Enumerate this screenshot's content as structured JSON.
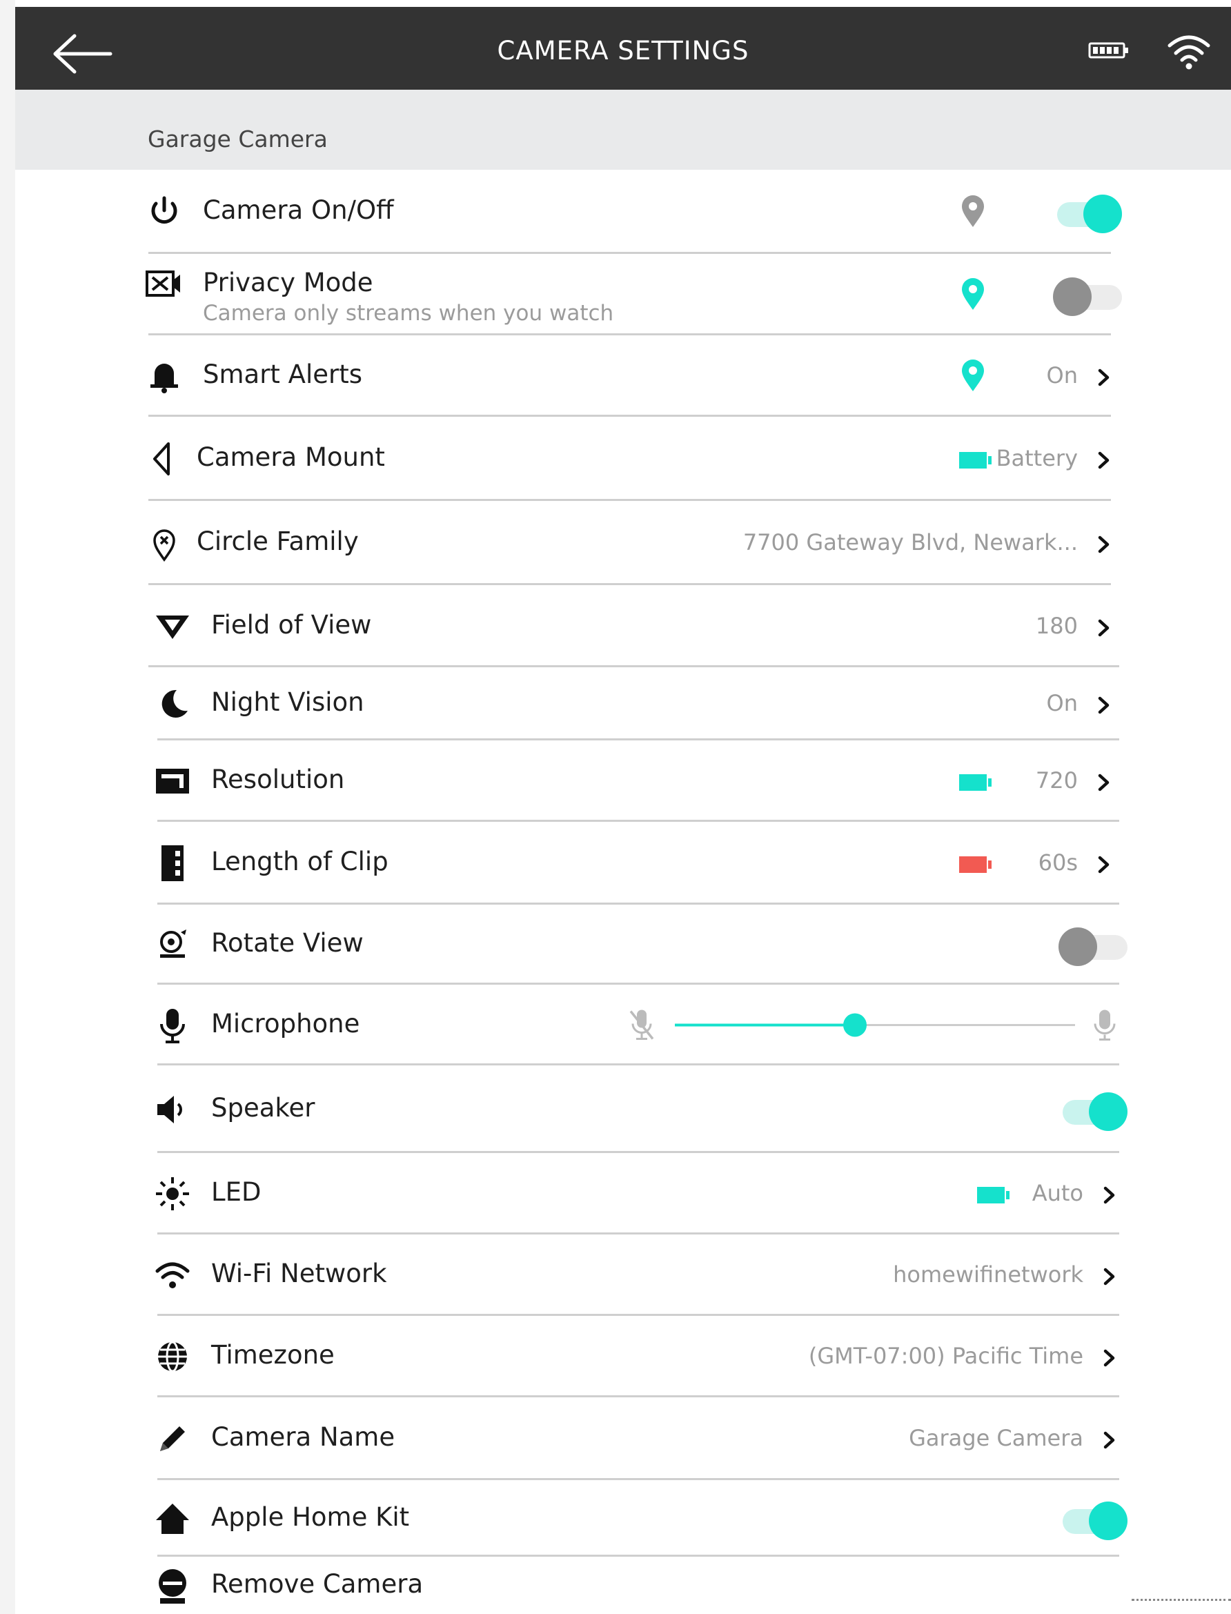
{
  "header": {
    "title": "CAMERA SETTINGS"
  },
  "section_label": "Garage Camera",
  "colors": {
    "accent": "#15e1cc",
    "warning": "#f25a52",
    "header_bg": "#333333"
  },
  "rows": [
    {
      "label": "Camera On/Off",
      "icon": "power-icon",
      "location_pin": "gray",
      "toggle": "on"
    },
    {
      "label": "Privacy Mode",
      "sublabel": "Camera only streams when you watch",
      "icon": "privacy-camera-icon",
      "location_pin": "teal",
      "toggle": "off"
    },
    {
      "label": "Smart Alerts",
      "icon": "bell-icon",
      "location_pin": "teal",
      "value": "On"
    },
    {
      "label": "Camera Mount",
      "icon": "mount-icon",
      "battery_indicator": "teal",
      "value": "Battery"
    },
    {
      "label": "Circle Family",
      "icon": "location-icon",
      "value": "7700 Gateway Blvd, Newark..."
    },
    {
      "label": "Field of View",
      "icon": "field-of-view-icon",
      "value": "180"
    },
    {
      "label": "Night Vision",
      "icon": "moon-icon",
      "value": "On"
    },
    {
      "label": "Resolution",
      "icon": "resolution-icon",
      "battery_indicator": "teal",
      "value": "720"
    },
    {
      "label": "Length of Clip",
      "icon": "film-strip-icon",
      "battery_indicator": "red",
      "value": "60s"
    },
    {
      "label": "Rotate View",
      "icon": "rotate-camera-icon",
      "toggle": "off"
    },
    {
      "label": "Microphone",
      "icon": "microphone-icon",
      "slider_level": 0.45
    },
    {
      "label": "Speaker",
      "icon": "speaker-icon",
      "toggle": "on"
    },
    {
      "label": "LED",
      "icon": "led-icon",
      "battery_indicator": "teal",
      "value": "Auto"
    },
    {
      "label": "Wi-Fi Network",
      "icon": "wifi-icon",
      "value": "homewifinetwork"
    },
    {
      "label": "Timezone",
      "icon": "globe-icon",
      "value": "(GMT-07:00) Pacific Time"
    },
    {
      "label": "Camera Name",
      "icon": "pencil-icon",
      "value": "Garage Camera"
    },
    {
      "label": "Apple Home Kit",
      "icon": "home-icon",
      "toggle": "on"
    },
    {
      "label": "Remove Camera",
      "icon": "remove-camera-icon"
    }
  ]
}
